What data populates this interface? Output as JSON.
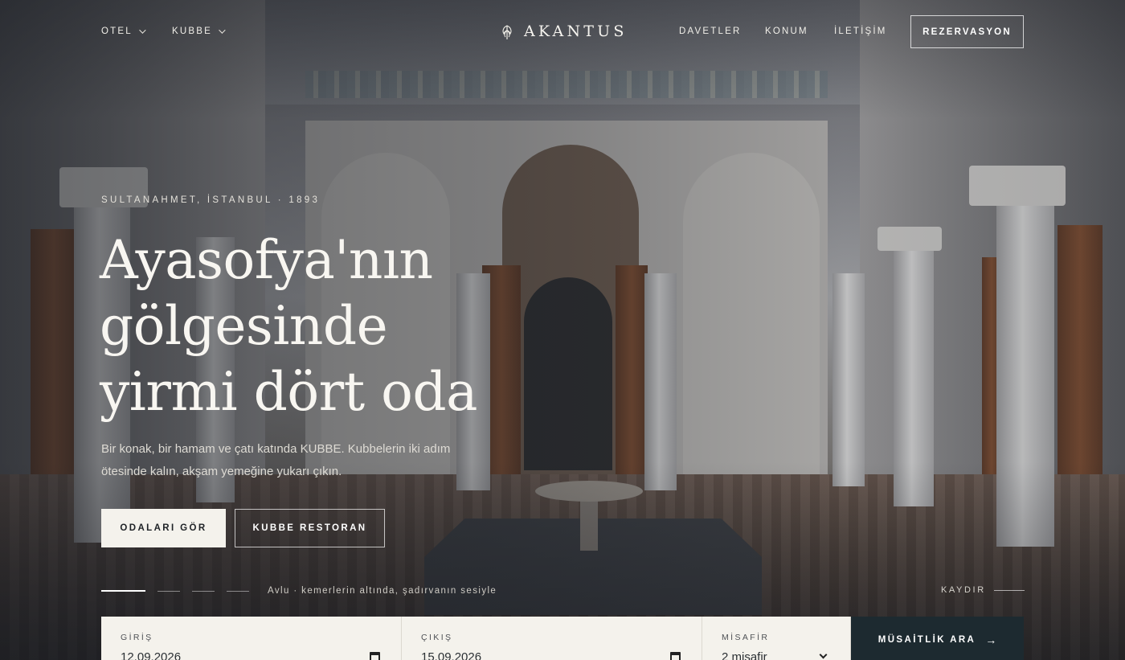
{
  "nav": {
    "left_items": [
      {
        "label": "OTEL"
      },
      {
        "label": "KUBBE"
      }
    ],
    "brand": "AKANTUS",
    "right_items": [
      {
        "label": "DAVETLER"
      },
      {
        "label": "KONUM"
      },
      {
        "label": "İLETİŞİM"
      }
    ],
    "reserve_label": "REZERVASYON"
  },
  "hero": {
    "eyebrow": "SULTANAHMET, İSTANBUL · 1893",
    "headline_lines": [
      "Ayasofya'nın",
      "gölgesinde",
      "yirmi dört oda"
    ],
    "lede": "Bir konak, bir hamam ve çatı katında KUBBE. Kubbelerin iki adım ötesinde kalın, akşam yemeğine yukarı çıkın.",
    "primary_cta": "ODALARI GÖR",
    "secondary_cta": "KUBBE RESTORAN",
    "slide_caption": "Avlu · kemerlerin altında, şadırvanın sesiyle",
    "slide_count": 4,
    "active_slide": 1,
    "scroll_label": "KAYDIR"
  },
  "booking": {
    "checkin_label": "GİRİŞ",
    "checkin_value": "12.09.2026",
    "checkout_label": "ÇIKIŞ",
    "checkout_value": "15.09.2026",
    "guests_label": "MİSAFİR",
    "guests_value": "2 misafir",
    "search_label": "MÜSAİTLİK ARA",
    "search_arrow": "→"
  },
  "colors": {
    "cta_dark": "#1d2a30",
    "cream": "#f4f2ec"
  }
}
